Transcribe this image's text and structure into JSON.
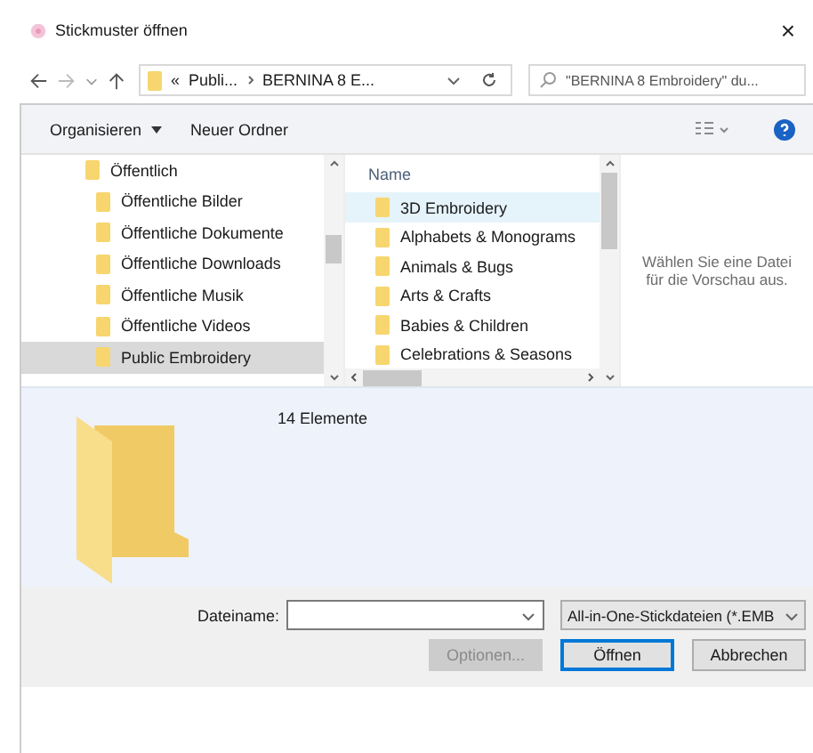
{
  "window": {
    "title": "Stickmuster öffnen",
    "close": "×"
  },
  "navigation": {
    "breadcrumb": [
      "Publi...",
      "BERNINA 8 E..."
    ],
    "overflow": "«",
    "search": {
      "placeholder": "\"BERNINA 8 Embroidery\" du..."
    }
  },
  "toolbar": {
    "organize": "Organisieren",
    "new_folder": "Neuer Ordner"
  },
  "tree": [
    {
      "label": "Öffentlich",
      "selected": false,
      "children": [
        {
          "label": "Öffentliche Bilder",
          "selected": false
        },
        {
          "label": "Öffentliche Dokumente",
          "selected": false
        },
        {
          "label": "Öffentliche Downloads",
          "selected": false
        },
        {
          "label": "Öffentliche Musik",
          "selected": false
        },
        {
          "label": "Öffentliche Videos",
          "selected": false
        },
        {
          "label": "Public Embroidery",
          "selected": true
        }
      ]
    }
  ],
  "file_list": {
    "column": "Name",
    "items": [
      {
        "name": "3D Embroidery",
        "selected": true
      },
      {
        "name": "Alphabets & Monograms",
        "selected": false
      },
      {
        "name": "Animals & Bugs",
        "selected": false
      },
      {
        "name": "Arts & Crafts",
        "selected": false
      },
      {
        "name": "Babies & Children",
        "selected": false
      },
      {
        "name": "Celebrations & Seasons",
        "selected": false
      }
    ]
  },
  "preview": {
    "message": "Wählen Sie eine Datei für die Vorschau aus."
  },
  "details": {
    "count": "14 Elemente"
  },
  "footer": {
    "filename_label": "Dateiname:",
    "filter": "All-in-One-Stickdateien (*.EMB",
    "buttons": [
      {
        "label": "Optionen...",
        "disabled": true,
        "default": false
      },
      {
        "label": "Öffnen",
        "disabled": false,
        "default": true
      },
      {
        "label": "Abbrechen",
        "disabled": false,
        "default": false
      }
    ]
  }
}
